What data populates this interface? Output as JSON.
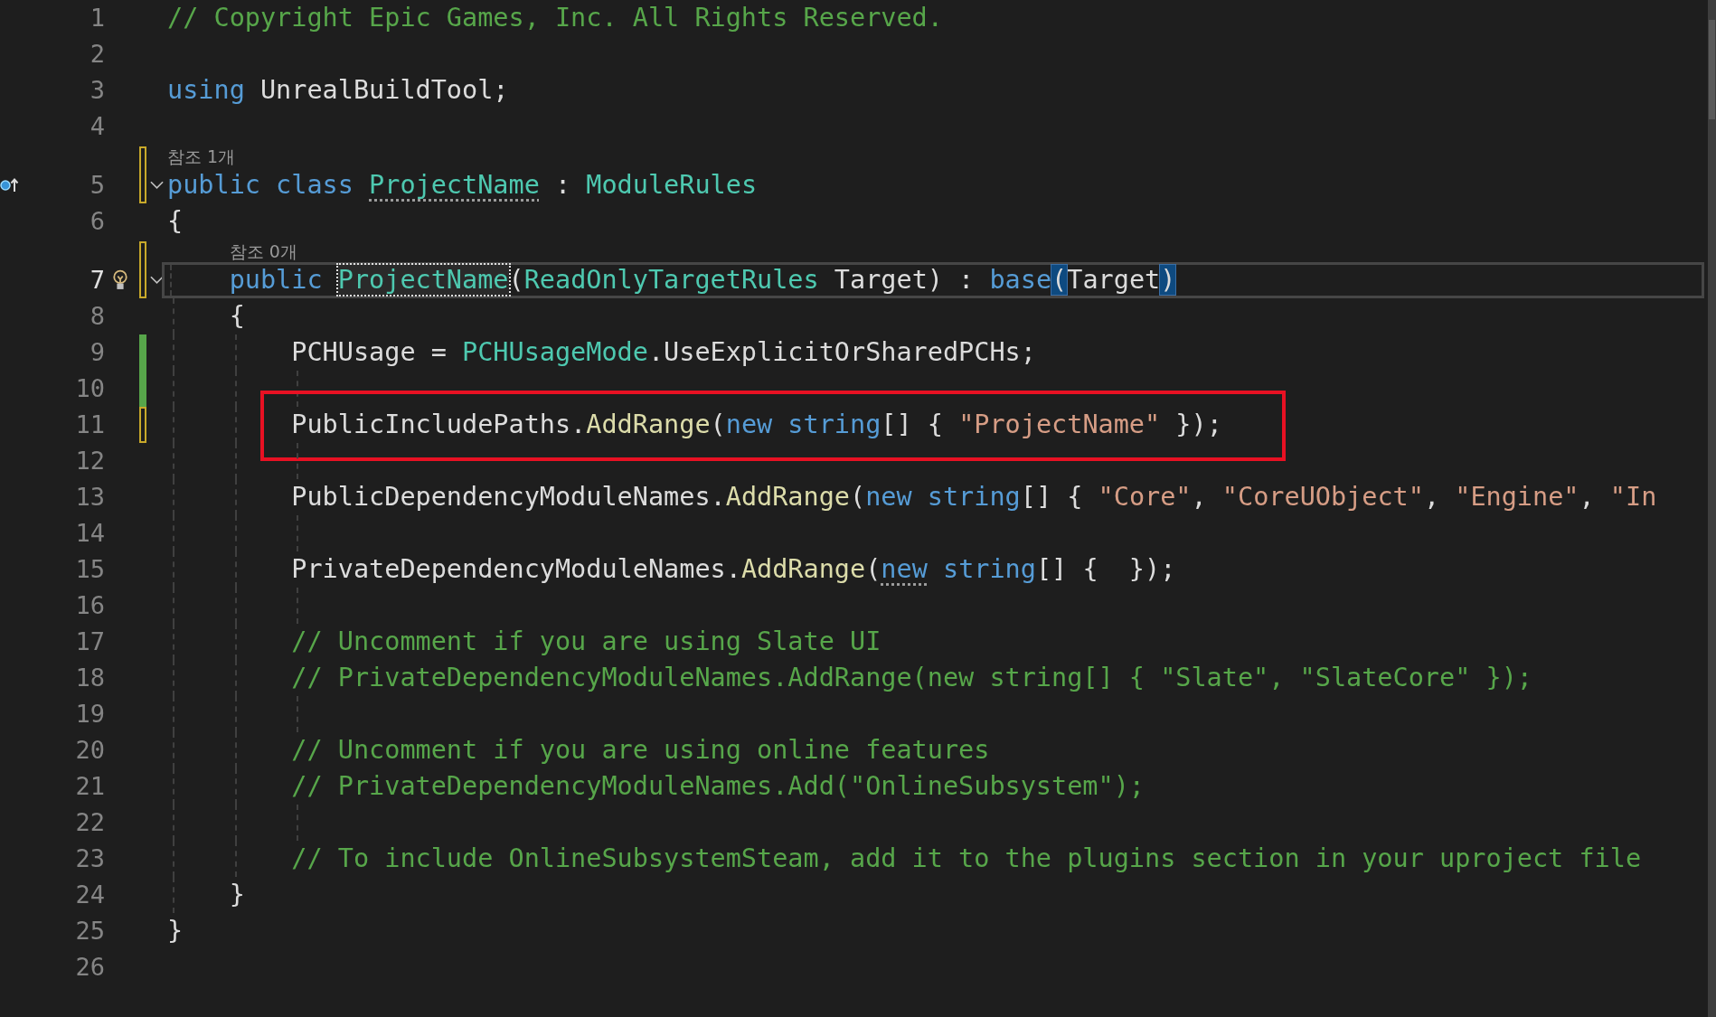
{
  "editor": {
    "lines": [
      {
        "number": "1",
        "current": false,
        "tokens": [
          {
            "t": "// Copyright Epic Games, Inc. All Rights Reserved.",
            "kind": "comment"
          }
        ]
      },
      {
        "number": "2",
        "current": false
      },
      {
        "number": "3",
        "current": false,
        "tokens": [
          {
            "t": "using",
            "kind": "keyword"
          },
          {
            "t": " UnrealBuildTool;",
            "kind": "plain"
          }
        ]
      },
      {
        "number": "4",
        "current": false
      },
      {
        "number": "5",
        "current": false,
        "code_lens": "참조 1개",
        "modified": true,
        "saved": true,
        "expanded": true,
        "base_type": true,
        "tokens": [
          {
            "t": "public class ",
            "kind": "keyword"
          },
          {
            "t": "ProjectName",
            "kind": "type",
            "hint": true
          },
          {
            "t": " : ",
            "kind": "plain"
          },
          {
            "t": "ModuleRules",
            "kind": "type"
          }
        ]
      },
      {
        "number": "6",
        "current": false,
        "tokens": [
          {
            "t": "{",
            "kind": "plain"
          }
        ]
      },
      {
        "number": "7",
        "current": true,
        "code_lens": "참조 0개",
        "modified": true,
        "saved": true,
        "expanded": true,
        "quick_actions": true,
        "tokens": [
          {
            "t": "    public ",
            "kind": "keyword"
          },
          {
            "t": "ProjectName",
            "kind": "type",
            "boxed": true
          },
          {
            "t": "(",
            "kind": "plain"
          },
          {
            "t": "ReadOnlyTargetRules",
            "kind": "type"
          },
          {
            "t": " Target) : ",
            "kind": "plain"
          },
          {
            "t": "base",
            "kind": "keyword"
          },
          {
            "t": "(",
            "kind": "plain",
            "match": true
          },
          {
            "t": "Target",
            "kind": "plain"
          },
          {
            "t": ")",
            "kind": "plain",
            "match": true
          }
        ]
      },
      {
        "number": "8",
        "current": false,
        "tokens": [
          {
            "t": "    {",
            "kind": "plain"
          }
        ]
      },
      {
        "number": "9",
        "current": false,
        "modified": true,
        "saved": false,
        "tokens": [
          {
            "t": "        PCHUsage = ",
            "kind": "plain"
          },
          {
            "t": "PCHUsageMode",
            "kind": "type"
          },
          {
            "t": ".UseExplicitOrSharedPCHs;",
            "kind": "plain"
          }
        ]
      },
      {
        "number": "10",
        "current": false,
        "modified": true,
        "saved": false
      },
      {
        "number": "11",
        "current": false,
        "modified": true,
        "saved": true,
        "highlighted": true,
        "tokens": [
          {
            "t": "        PublicIncludePaths.",
            "kind": "plain"
          },
          {
            "t": "AddRange",
            "kind": "method"
          },
          {
            "t": "(",
            "kind": "plain"
          },
          {
            "t": "new string",
            "kind": "keyword"
          },
          {
            "t": "[] { ",
            "kind": "plain"
          },
          {
            "t": "\"ProjectName\"",
            "kind": "string"
          },
          {
            "t": " });",
            "kind": "plain"
          }
        ]
      },
      {
        "number": "12",
        "current": false
      },
      {
        "number": "13",
        "current": false,
        "tokens": [
          {
            "t": "        PublicDependencyModuleNames.",
            "kind": "plain"
          },
          {
            "t": "AddRange",
            "kind": "method"
          },
          {
            "t": "(",
            "kind": "plain"
          },
          {
            "t": "new string",
            "kind": "keyword"
          },
          {
            "t": "[] { ",
            "kind": "plain"
          },
          {
            "t": "\"Core\"",
            "kind": "string"
          },
          {
            "t": ", ",
            "kind": "plain"
          },
          {
            "t": "\"CoreUObject\"",
            "kind": "string"
          },
          {
            "t": ", ",
            "kind": "plain"
          },
          {
            "t": "\"Engine\"",
            "kind": "string"
          },
          {
            "t": ", ",
            "kind": "plain"
          },
          {
            "t": "\"In",
            "kind": "string"
          }
        ]
      },
      {
        "number": "14",
        "current": false
      },
      {
        "number": "15",
        "current": false,
        "tokens": [
          {
            "t": "        PrivateDependencyModuleNames.",
            "kind": "plain"
          },
          {
            "t": "AddRange",
            "kind": "method"
          },
          {
            "t": "(",
            "kind": "plain"
          },
          {
            "t": "new",
            "kind": "keyword",
            "hint": true
          },
          {
            "t": " string",
            "kind": "keyword"
          },
          {
            "t": "[] {  });",
            "kind": "plain"
          }
        ]
      },
      {
        "number": "16",
        "current": false
      },
      {
        "number": "17",
        "current": false,
        "tokens": [
          {
            "t": "        // Uncomment if you are using Slate UI",
            "kind": "comment"
          }
        ]
      },
      {
        "number": "18",
        "current": false,
        "tokens": [
          {
            "t": "        // PrivateDependencyModuleNames.AddRange(new string[] { \"Slate\", \"SlateCore\" });",
            "kind": "comment"
          }
        ]
      },
      {
        "number": "19",
        "current": false
      },
      {
        "number": "20",
        "current": false,
        "tokens": [
          {
            "t": "        // Uncomment if you are using online features",
            "kind": "comment"
          }
        ]
      },
      {
        "number": "21",
        "current": false,
        "tokens": [
          {
            "t": "        // PrivateDependencyModuleNames.Add(\"OnlineSubsystem\");",
            "kind": "comment"
          }
        ]
      },
      {
        "number": "22",
        "current": false
      },
      {
        "number": "23",
        "current": false,
        "tokens": [
          {
            "t": "        // To include OnlineSubsystemSteam, add it to the plugins section in your uproject file",
            "kind": "comment"
          }
        ]
      },
      {
        "number": "24",
        "current": false,
        "tokens": [
          {
            "t": "    }",
            "kind": "plain"
          }
        ]
      },
      {
        "number": "25",
        "current": false,
        "tokens": [
          {
            "t": "}",
            "kind": "plain"
          }
        ]
      },
      {
        "number": "26",
        "current": false
      }
    ]
  }
}
